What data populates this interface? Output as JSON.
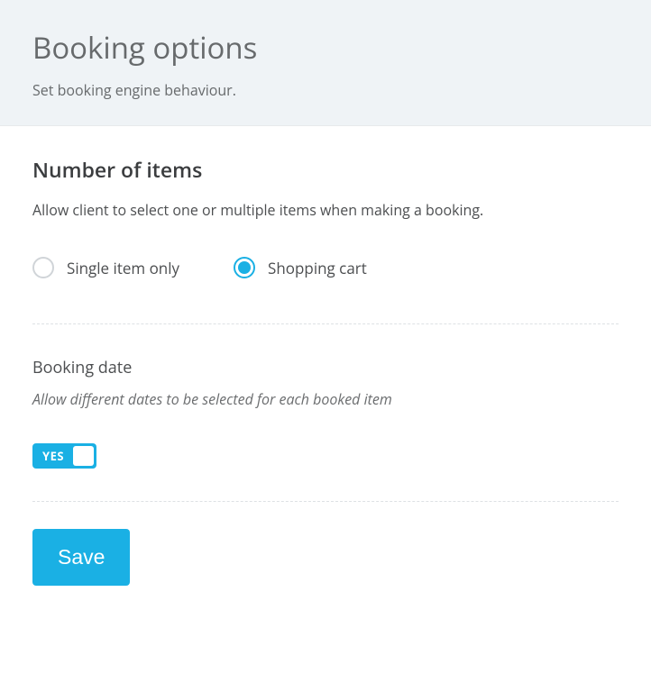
{
  "header": {
    "title": "Booking options",
    "subtitle": "Set booking engine behaviour."
  },
  "numberOfItems": {
    "title": "Number of items",
    "description": "Allow client to select one or multiple items when making a booking.",
    "options": {
      "single": "Single item only",
      "cart": "Shopping cart"
    },
    "selected": "cart"
  },
  "bookingDate": {
    "title": "Booking date",
    "description": "Allow different dates to be selected for each booked item",
    "toggle": {
      "state": true,
      "label": "YES"
    }
  },
  "actions": {
    "save": "Save"
  }
}
